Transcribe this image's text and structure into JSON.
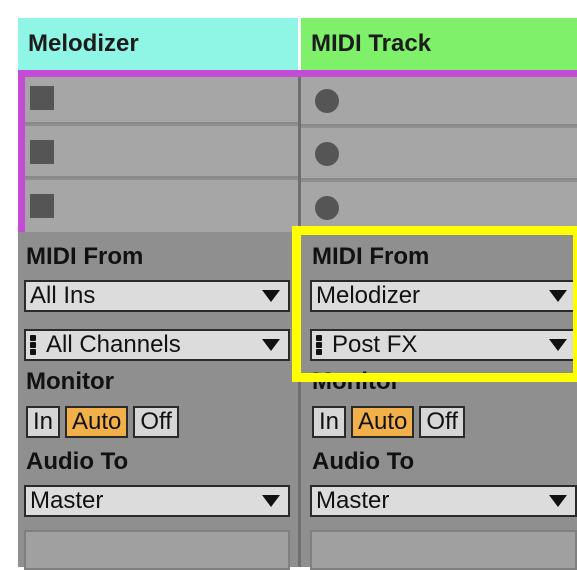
{
  "tracks": [
    {
      "name": "Melodizer",
      "header_color": "#8ff5e4",
      "midi_from_label": "MIDI From",
      "input_source": "All Ins",
      "input_channel": "All Channels",
      "monitor_label": "Monitor",
      "monitor_buttons": [
        "In",
        "Auto",
        "Off"
      ],
      "monitor_active": "Auto",
      "audio_to_label": "Audio To",
      "output": "Master"
    },
    {
      "name": "MIDI Track",
      "header_color": "#7ef06a",
      "midi_from_label": "MIDI From",
      "input_source": "Melodizer",
      "input_channel": "Post FX",
      "monitor_label": "Monitor",
      "monitor_buttons": [
        "In",
        "Auto",
        "Off"
      ],
      "monitor_active": "Auto",
      "audio_to_label": "Audio To",
      "output": "Master"
    }
  ],
  "colors": {
    "selection_outline": "#c34bd6",
    "highlight_box": "#ffff00",
    "active_button": "#f2b04a"
  }
}
